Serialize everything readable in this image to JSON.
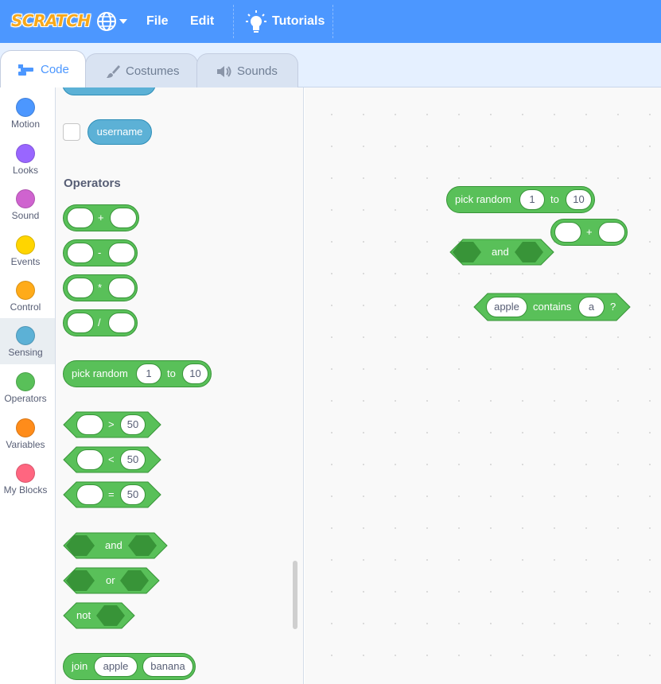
{
  "menubar": {
    "logo": "SCRATCH",
    "file": "File",
    "edit": "Edit",
    "tutorials": "Tutorials",
    "color": "#4c97ff"
  },
  "tabs": [
    {
      "label": "Code",
      "active": true,
      "icon": "code-icon"
    },
    {
      "label": "Costumes",
      "active": false,
      "icon": "brush-icon"
    },
    {
      "label": "Sounds",
      "active": false,
      "icon": "speaker-icon"
    }
  ],
  "categories": [
    {
      "label": "Motion",
      "color": "#4c97ff"
    },
    {
      "label": "Looks",
      "color": "#9966ff"
    },
    {
      "label": "Sound",
      "color": "#cf63cf"
    },
    {
      "label": "Events",
      "color": "#ffd500"
    },
    {
      "label": "Control",
      "color": "#ffab19"
    },
    {
      "label": "Sensing",
      "color": "#5cb1d6",
      "selected": true
    },
    {
      "label": "Operators",
      "color": "#59c059"
    },
    {
      "label": "Variables",
      "color": "#ff8c1a"
    },
    {
      "label": "My Blocks",
      "color": "#ff6680"
    }
  ],
  "palette": {
    "username_block": "username",
    "operators_title": "Operators",
    "arith_ops": [
      "+",
      "-",
      "*",
      "/"
    ],
    "pick_random": {
      "label": "pick random",
      "from": "1",
      "to_label": "to",
      "to": "10"
    },
    "compare_ops": [
      {
        "op": ">",
        "value": "50"
      },
      {
        "op": "<",
        "value": "50"
      },
      {
        "op": "=",
        "value": "50"
      }
    ],
    "and_label": "and",
    "or_label": "or",
    "not_label": "not",
    "join": {
      "label": "join",
      "a": "apple",
      "b": "banana"
    }
  },
  "workspace": {
    "pick_random": {
      "label": "pick random",
      "from": "1",
      "to_label": "to",
      "to": "10"
    },
    "plus_op": "+",
    "and_label": "and",
    "contains": {
      "a": "apple",
      "label": "contains",
      "b": "a",
      "q": "?"
    }
  }
}
